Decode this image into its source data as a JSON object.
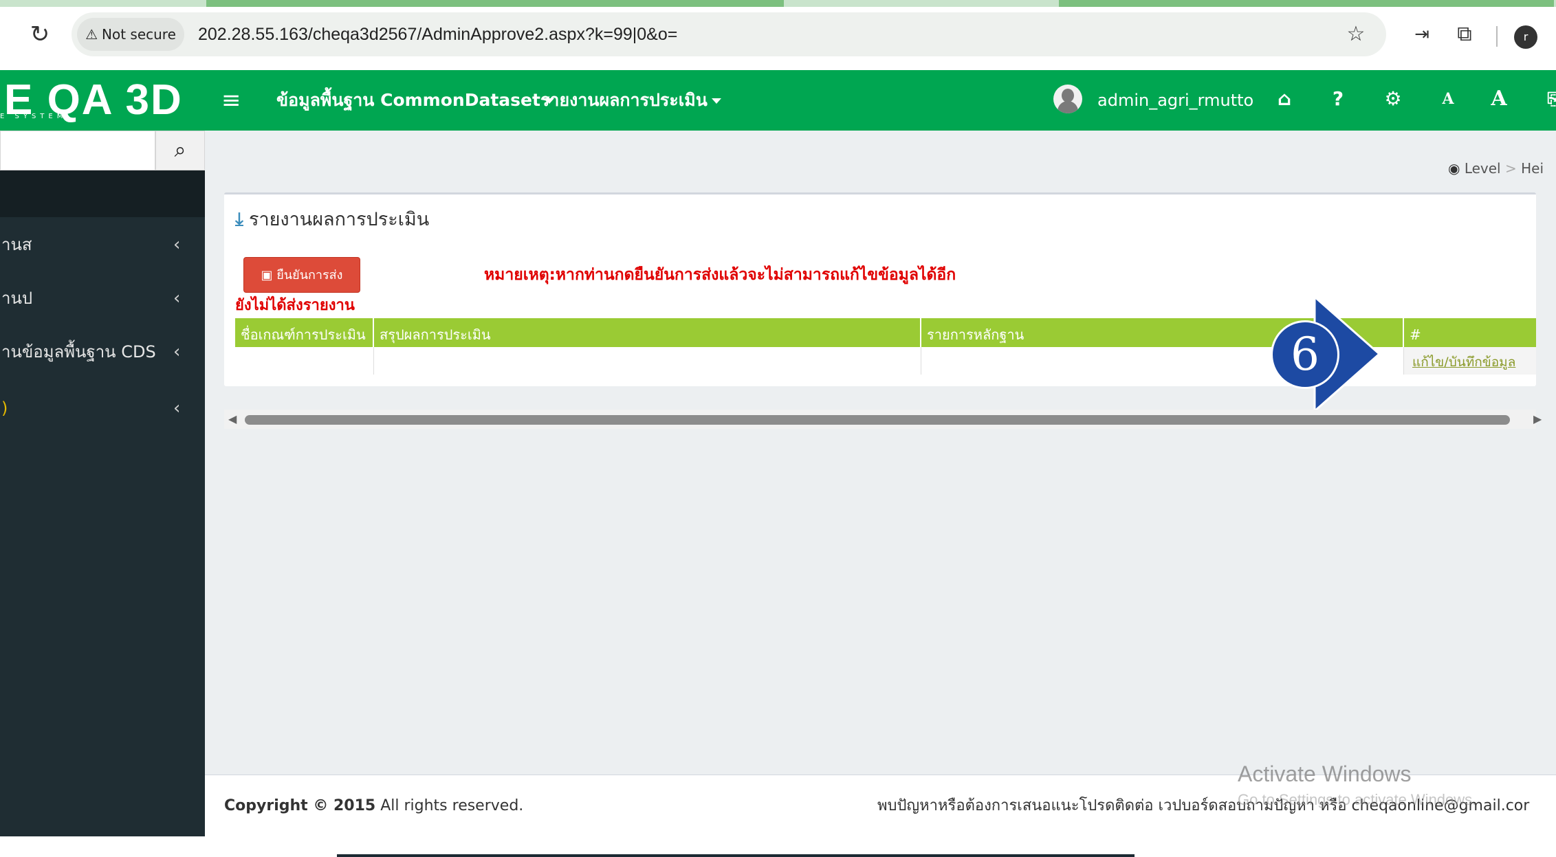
{
  "browser": {
    "security_label": "Not secure",
    "url": "202.28.55.163/cheqa3d2567/AdminApprove2.aspx?k=99|0&o="
  },
  "header": {
    "logo_text": "E QA 3D",
    "logo_sub": "E SYSTEM",
    "nav": [
      {
        "label": "ข้อมูลพื้นฐาน CommonDataset"
      },
      {
        "label": "รายงานผลการประเมิน"
      }
    ],
    "username": "admin_agri_rmutto",
    "font_small": "A",
    "font_large": "A"
  },
  "sidebar": {
    "items": [
      {
        "label": "านส"
      },
      {
        "label": "านป"
      },
      {
        "label": "านข้อมูลพื้นฐาน CDS"
      },
      {
        "label": ")"
      }
    ]
  },
  "breadcrumb": {
    "level": "Level",
    "separator": ">",
    "next": "Hei"
  },
  "main": {
    "box_title": "รายงานผลการประเมิน",
    "confirm_button": "ยืนยันการส่ง",
    "note": "หมายเหตุ:หากท่านกดยืนยันการส่งแล้วจะไม่สามารถแก้ไขข้อมูลได้อีก",
    "status": "ยังไม่ได้ส่งรายงาน",
    "table": {
      "headers": [
        "ชื่อเกณฑ์การประเมิน",
        "สรุปผลการประเมิน",
        "รายการหลักฐาน",
        "#"
      ],
      "rows": [
        {
          "criterion": "",
          "summary": "",
          "evidence": "",
          "action": "แก้ไข/บันทึกข้อมูล"
        }
      ]
    },
    "callout_number": "6"
  },
  "footer": {
    "copyright_bold": "Copyright © 2015",
    "copyright_rest": " All rights reserved.",
    "contact": "พบปัญหาหรือต้องการเสนอแนะโปรดติดต่อ เวปบอร์ดสอบถามปัญหา หรือ cheqaonline@gmail.cor"
  },
  "watermark": {
    "line1": "Activate Windows",
    "line2": "Go to Settings to activate Windows."
  },
  "colors": {
    "header": "#00a651",
    "sidebar": "#1f2d33",
    "table_header": "#9acb34",
    "danger": "#dd4b39",
    "callout": "#1d4aa3"
  }
}
